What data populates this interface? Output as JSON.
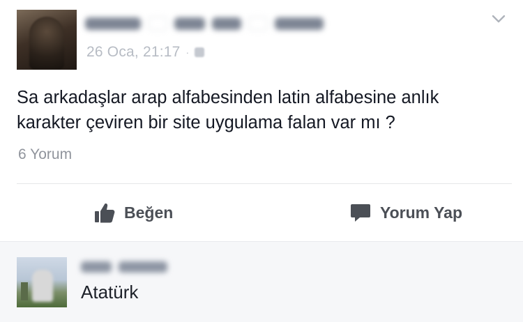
{
  "post": {
    "timestamp": "26 Oca, 21:17",
    "separator": "·",
    "text_line1": "Sa arkadaşlar arap alfabesinden latin alfabesine anlık",
    "text_line2": "karakter çeviren bir site uygulama falan var mı ?",
    "comment_count": "6 Yorum"
  },
  "actions": {
    "like_label": "Beğen",
    "comment_label": "Yorum Yap"
  },
  "comment": {
    "text": "Atatürk"
  },
  "icons": {
    "options": "chevron-down-icon",
    "privacy": "globe-icon",
    "like": "thumbs-up-icon",
    "comment": "speech-bubble-icon"
  },
  "colors": {
    "text_primary": "#141823",
    "text_secondary": "#90949c",
    "action_text": "#4b4f56",
    "comment_bg": "#f6f7f9"
  }
}
